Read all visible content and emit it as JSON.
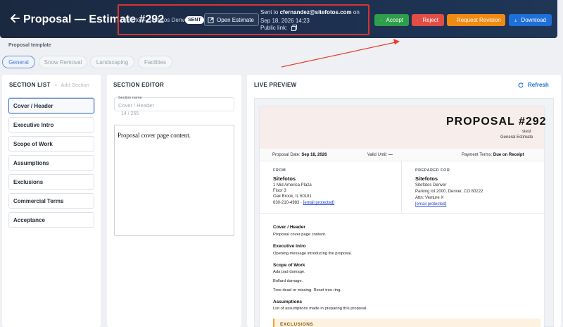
{
  "header": {
    "title": "Proposal — Estimate #292",
    "company": "Sitefotos · Sitefotos Denver",
    "status_badge": "SENT",
    "open_estimate_label": "Open Estimate",
    "sent_prefix": "Sent to",
    "sent_email": "cfernandez@sitefotos.com",
    "sent_suffix": "on Sep 18, 2026 14:23",
    "public_link_label": "Public link:",
    "buttons": {
      "accept": "Accept",
      "reject": "Reject",
      "request_revision": "Request Revision",
      "download": "Download"
    }
  },
  "template": {
    "label": "Proposal template",
    "tabs": [
      {
        "label": "General",
        "active": true
      },
      {
        "label": "Snow Removal",
        "active": false
      },
      {
        "label": "Landscaping",
        "active": false
      },
      {
        "label": "Facilities",
        "active": false
      }
    ]
  },
  "section_list": {
    "title": "SECTION LIST",
    "add_label": "Add Section",
    "items": [
      "Cover / Header",
      "Executive Intro",
      "Scope of Work",
      "Assumptions",
      "Exclusions",
      "Commercial Terms",
      "Acceptance"
    ]
  },
  "section_editor": {
    "title": "SECTION EDITOR",
    "name_label": "Section name",
    "name_value": "Cover / Header",
    "counter": "14 / 255",
    "content": "Proposal cover page content."
  },
  "live_preview": {
    "title": "LIVE PREVIEW",
    "refresh_label": "Refresh",
    "doc": {
      "title": "PROPOSAL #292",
      "subtitle": "stest",
      "type": "General Estimate",
      "proposal_date_label": "Proposal Date:",
      "proposal_date": "Sep 18, 2026",
      "valid_until_label": "Valid Until:",
      "valid_until": "—",
      "payment_terms_label": "Payment Terms:",
      "payment_terms": "Due on Receipt",
      "from": {
        "label": "FROM",
        "name": "Sitefotos",
        "line1": "1 Mid America Plaza",
        "line2": "Floor 3",
        "line3": "Oak Brook, IL 60181",
        "phone": "630-210-4983 ·",
        "email": "[email protected]"
      },
      "prepared_for": {
        "label": "PREPARED FOR",
        "name": "Sitefotos",
        "line1": "Sitefotos Denver",
        "line2": "Parking lot 2000, Denver, CO 80222",
        "line3": "Attn: Venture X",
        "email": "[email protected]"
      },
      "sections": [
        {
          "heading": "Cover / Header",
          "lines": [
            "Proposal cover page content."
          ]
        },
        {
          "heading": "Executive Intro",
          "lines": [
            "Opening message introducing the proposal."
          ]
        },
        {
          "heading": "Scope of Work",
          "lines": [
            "Ada pad damage.",
            "Bollard damage.",
            "Tree dead or missing. Reset tree ring."
          ]
        },
        {
          "heading": "Assumptions",
          "lines": [
            "List of assumptions made in preparing this proposal."
          ]
        }
      ],
      "exclusions_heading": "EXCLUSIONS"
    }
  },
  "colors": {
    "topbar": "#1d3050",
    "accept": "#2f9e4a",
    "reject": "#e24d45",
    "request_revision": "#ef8a12",
    "download": "#1e6fd9",
    "highlight_box": "#d8332f"
  }
}
